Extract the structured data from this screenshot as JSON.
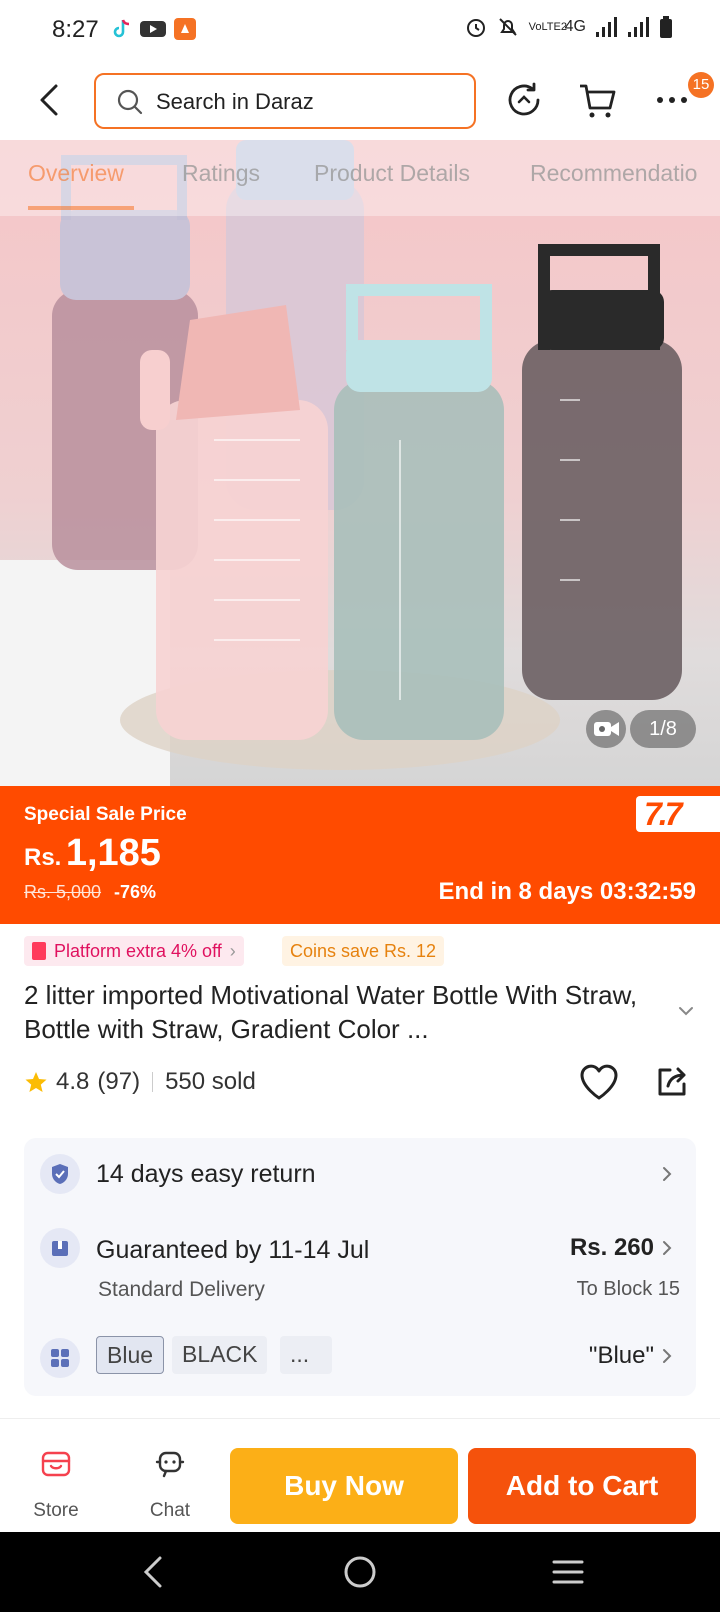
{
  "status_bar": {
    "time": "8:27",
    "network": "4G",
    "volte": "VoLTE2"
  },
  "header": {
    "search_placeholder": "Search in Daraz",
    "cart_count_badge": "15"
  },
  "tabs": [
    {
      "label": "Overview",
      "active": true
    },
    {
      "label": "Ratings",
      "active": false
    },
    {
      "label": "Product Details",
      "active": false
    },
    {
      "label": "Recommendatio",
      "active": false
    }
  ],
  "gallery": {
    "counter": "1/8"
  },
  "sale": {
    "label": "Special Sale Price",
    "currency": "Rs.",
    "price": "1,185",
    "original_price": "Rs. 5,000",
    "discount": "-76%",
    "countdown": "End in 8 days 03:32:59",
    "campaign_logo": "7.7"
  },
  "promos": {
    "platform": "Platform extra 4% off",
    "coins": "Coins save Rs. 12"
  },
  "product": {
    "title": "2 litter imported Motivational Water Bottle With Straw, Bottle with Straw, Gradient Color ...",
    "rating": "4.8",
    "reviews": "(97)",
    "sold": "550 sold"
  },
  "info": {
    "return_text": "14 days easy return",
    "delivery_title": "Guaranteed by 11-14 Jul",
    "delivery_type": "Standard Delivery",
    "delivery_price": "Rs. 260",
    "delivery_location": "To Block 15",
    "options": [
      "Blue",
      "BLACK",
      "..."
    ],
    "selected_option": "\"Blue\""
  },
  "actions": {
    "store": "Store",
    "chat": "Chat",
    "buy_now": "Buy Now",
    "add_to_cart": "Add to Cart"
  },
  "colors": {
    "accent": "#f57224",
    "sale_bg": "#ff4b00",
    "buy_now": "#fcaf17",
    "add_to_cart": "#f5520c"
  }
}
